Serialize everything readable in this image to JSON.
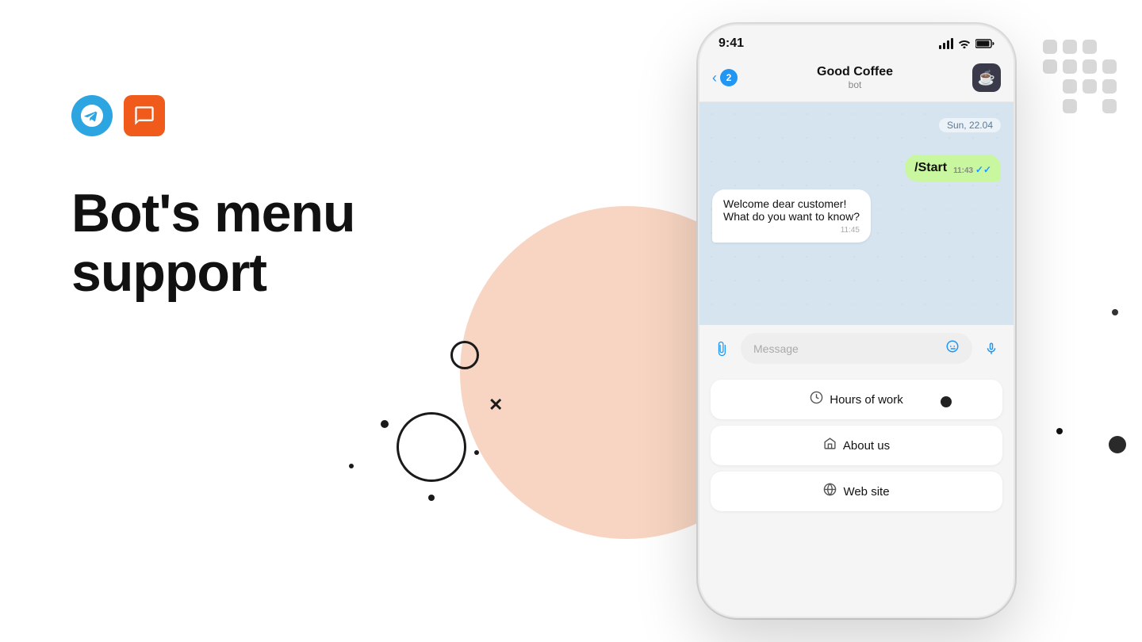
{
  "page": {
    "title": "Bot's menu support"
  },
  "left": {
    "headline_line1": "Bot's menu",
    "headline_line2": "support"
  },
  "phone": {
    "status_time": "9:41",
    "chat_name": "Good Coffee",
    "chat_type": "bot",
    "unread_count": "2",
    "date_label": "Sun, 22.04",
    "message_out_text": "/Start",
    "message_out_time": "11:43",
    "message_in_text_line1": "Welcome dear customer!",
    "message_in_text_line2": "What do you want to know?",
    "message_in_time": "11:45",
    "message_placeholder": "Message",
    "menu_btn1": "Hours of work",
    "menu_btn2": "About us",
    "menu_btn3": "Web site"
  }
}
